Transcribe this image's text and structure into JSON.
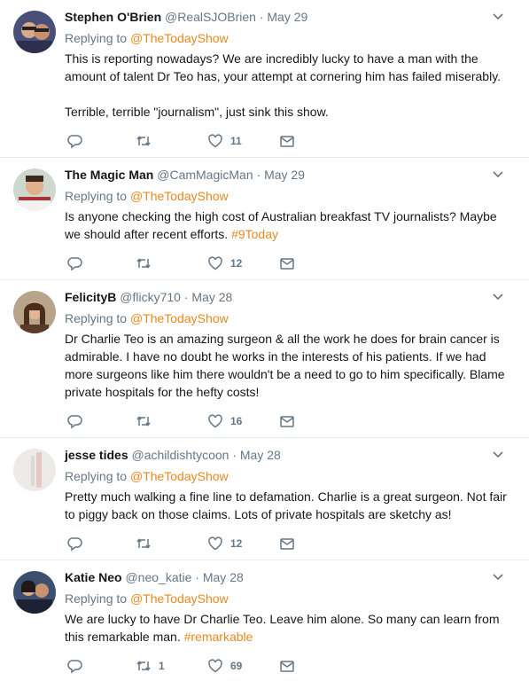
{
  "tweets": [
    {
      "name": "Stephen O'Brien",
      "handle": "@RealSJOBrien",
      "date": "May 29",
      "replying_prefix": "Replying to",
      "mention": "@TheTodayShow",
      "text1": "This is reporting nowadays? We are incredibly lucky to have a man with the amount of talent Dr Teo has, your attempt at cornering him has failed miserably.",
      "text2": "Terrible, terrible \"journalism\", just sink this show.",
      "likes": "11",
      "retweets": ""
    },
    {
      "name": "The Magic Man",
      "handle": "@CamMagicMan",
      "date": "May 29",
      "replying_prefix": "Replying to",
      "mention": "@TheTodayShow",
      "text1": "Is anyone checking the high cost of Australian breakfast TV journalists? Maybe we should after recent efforts.",
      "hashtag": "#9Today",
      "likes": "12",
      "retweets": ""
    },
    {
      "name": "FelicityB",
      "handle": "@flicky710",
      "date": "May 28",
      "replying_prefix": "Replying to",
      "mention": "@TheTodayShow",
      "text1": "Dr Charlie Teo is an amazing surgeon & all the work he does for brain cancer is admirable. I have no doubt he works in the interests of his patients. If we had more surgeons like him there wouldn't be a need to go to him specifically. Blame private hospitals for the hefty costs!",
      "likes": "16",
      "retweets": ""
    },
    {
      "name": "jesse tides",
      "handle": "@achildishtycoon",
      "date": "May 28",
      "replying_prefix": "Replying to",
      "mention": "@TheTodayShow",
      "text1": "Pretty much walking a fine line to defamation. Charlie is a great surgeon. Not fair to piggy back on those claims. Lots of private hospitals are sketchy as!",
      "likes": "12",
      "retweets": ""
    },
    {
      "name": "Katie Neo",
      "handle": "@neo_katie",
      "date": "May 28",
      "replying_prefix": "Replying to",
      "mention": "@TheTodayShow",
      "text1": "We are lucky to have Dr Charlie Teo. Leave him alone. So many can learn from this remarkable man.",
      "hashtag": "#remarkable",
      "likes": "69",
      "retweets": "1"
    }
  ],
  "colors": {
    "accent": "#e8891f",
    "muted": "#657786",
    "text": "#14171a",
    "divider": "#e6ecf0"
  },
  "icons": [
    "reply-icon",
    "retweet-icon",
    "like-icon",
    "dm-icon",
    "chevron-down-icon"
  ]
}
